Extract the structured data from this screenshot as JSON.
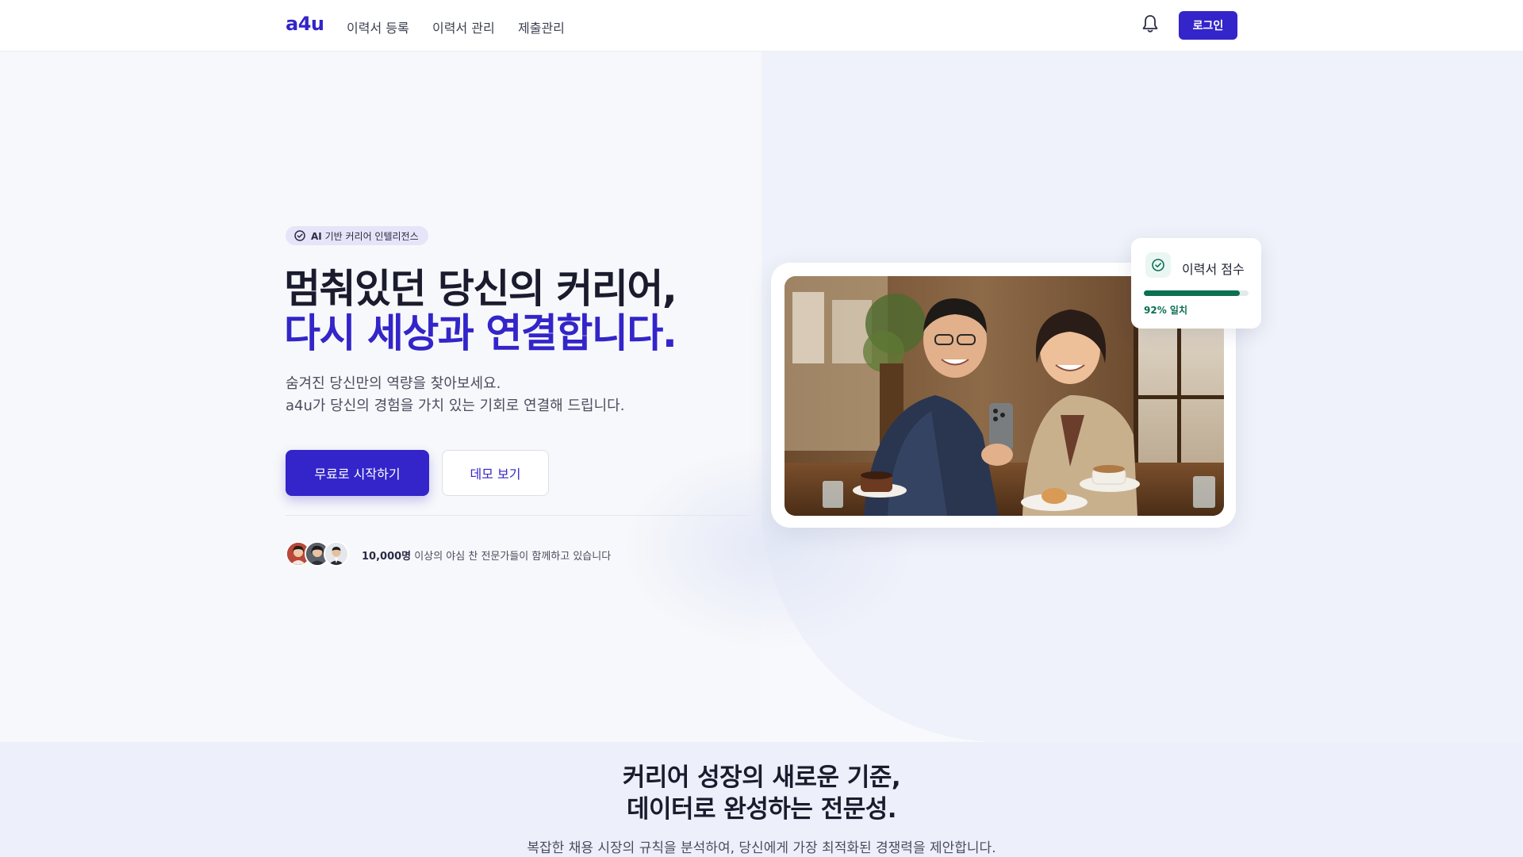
{
  "nav": {
    "logo": "a4u",
    "links": [
      "이력서 등록",
      "이력서 관리",
      "제출관리"
    ],
    "login_label": "로그인"
  },
  "hero": {
    "badge_bold": "AI",
    "badge_text": "기반 커리어 인텔리전스",
    "title_line1": "멈춰있던 당신의 커리어,",
    "title_line2": "다시 세상과 연결합니다.",
    "subtitle_line1": "숨겨진 당신만의 역량을 찾아보세요.",
    "subtitle_line2": "a4u가 당신의 경험을 가치 있는 기회로 연결해 드립니다.",
    "cta_primary": "무료로 시작하기",
    "cta_secondary": "데모 보기",
    "social_bold": "10,000명",
    "social_text": "이상의 야심 찬 전문가들이 함께하고 있습니다"
  },
  "score_card": {
    "title": "이력서 점수",
    "value_label": "92% 일치",
    "value": 0.92
  },
  "section2": {
    "title_line1": "커리어 성장의 새로운 기준,",
    "title_line2": "데이터로 완성하는 전문성.",
    "subtitle": "복잡한 채용 시장의 규칙을 분석하여, 당신에게 가장 최적화된 경쟁력을 제안합니다."
  },
  "colors": {
    "brand": "#3325c9",
    "success": "#0c7053"
  },
  "icons": [
    "bell-icon",
    "check-circle-icon",
    "avatar"
  ]
}
